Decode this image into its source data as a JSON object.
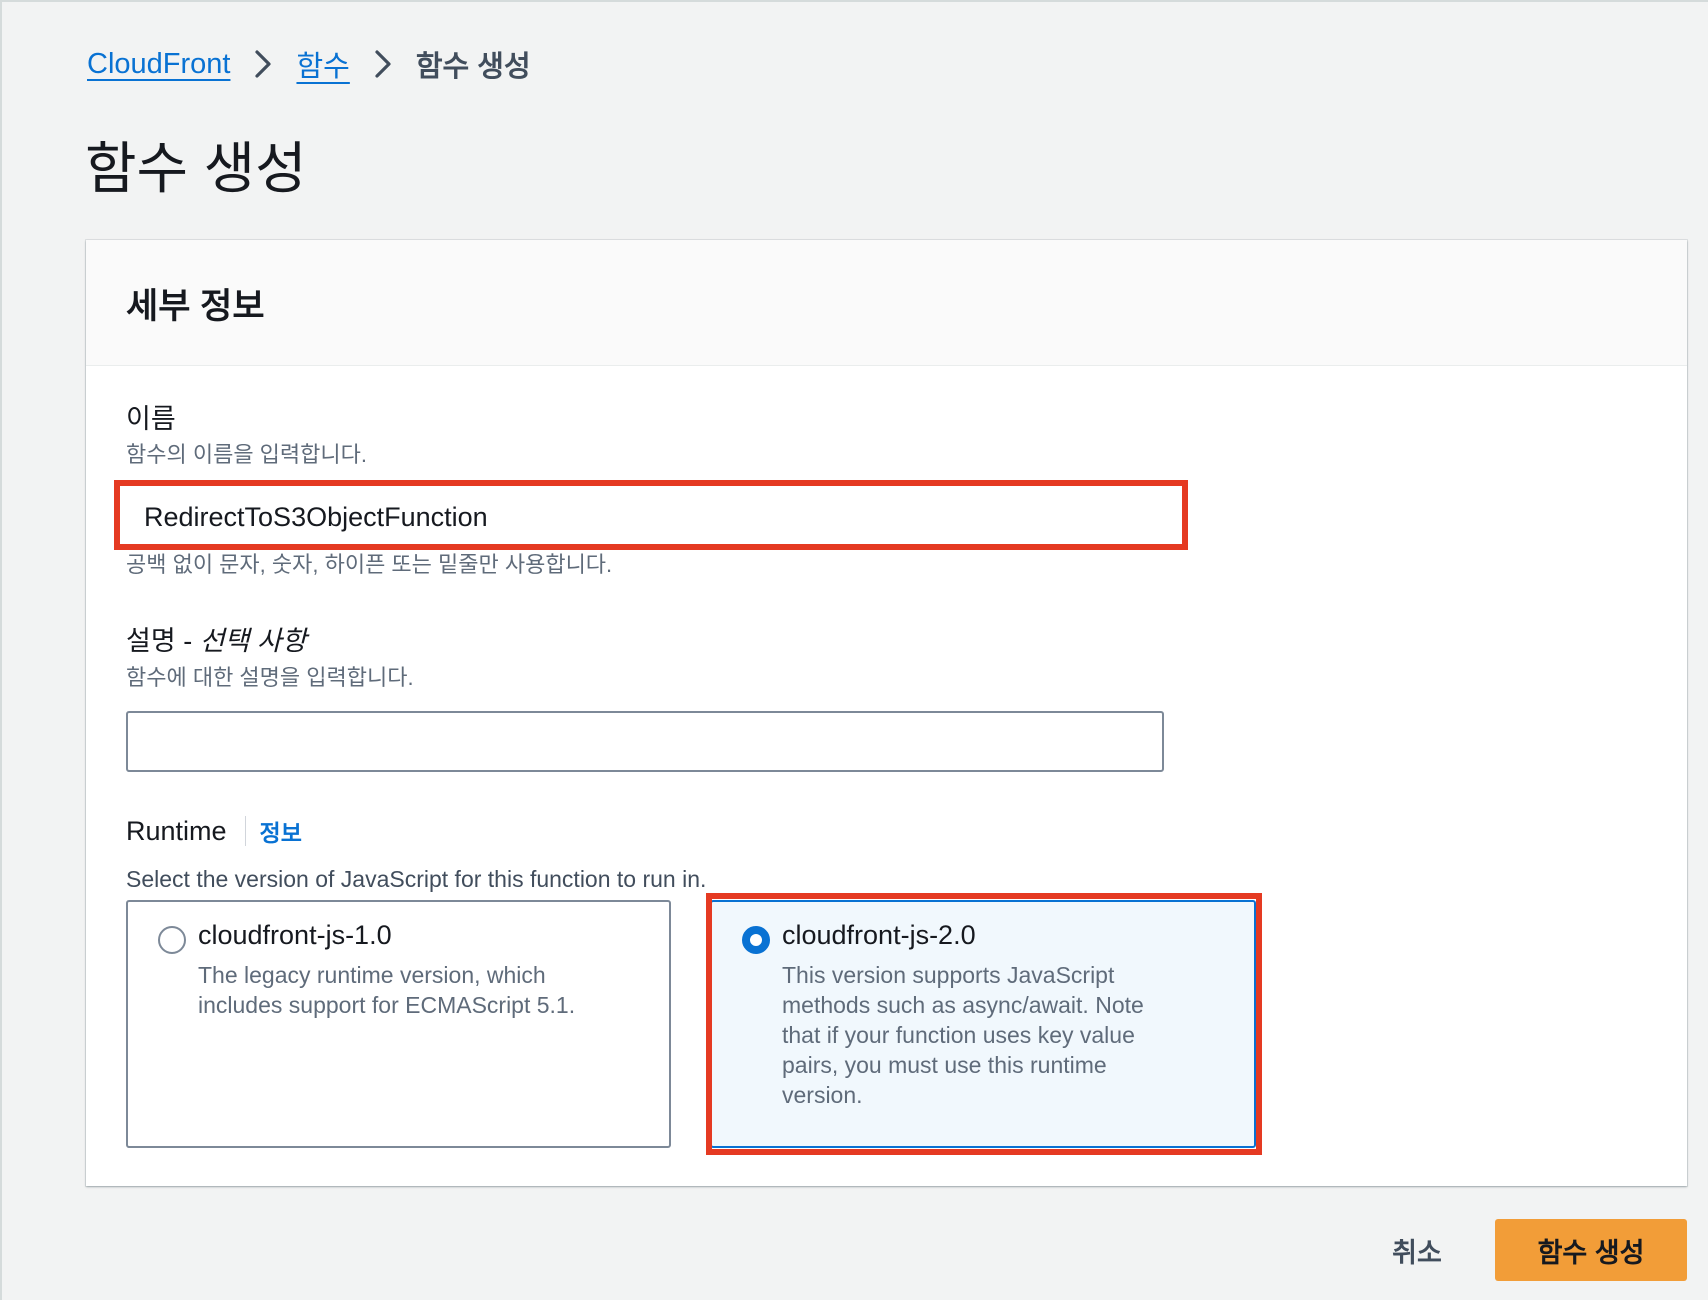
{
  "breadcrumb": {
    "items": [
      {
        "label": "CloudFront"
      },
      {
        "label": "함수"
      },
      {
        "label": "함수 생성"
      }
    ]
  },
  "page": {
    "title": "함수 생성"
  },
  "panel": {
    "title": "세부 정보"
  },
  "name_field": {
    "label": "이름",
    "description": "함수의 이름을 입력합니다.",
    "value": "RedirectToS3ObjectFunction",
    "constraint": "공백 없이 문자, 숫자, 하이픈 또는 밑줄만 사용합니다."
  },
  "description_field": {
    "label": "설명",
    "label_separator": " - ",
    "optional_label": "선택 사항",
    "description": "함수에 대한 설명을 입력합니다.",
    "value": ""
  },
  "runtime": {
    "label": "Runtime",
    "info_link": "정보",
    "description": "Select the version of JavaScript for this function to run in.",
    "options": [
      {
        "title": "cloudfront-js-1.0",
        "description": "The legacy runtime version, which includes support for ECMAScript 5.1.",
        "selected": false
      },
      {
        "title": "cloudfront-js-2.0",
        "description": "This version supports JavaScript methods such as async/await. Note that if your function uses key value pairs, you must use this runtime version.",
        "selected": true
      }
    ]
  },
  "actions": {
    "cancel_label": "취소",
    "submit_label": "함수 생성"
  },
  "colors": {
    "accent": "#0972d3",
    "primary_button": "#f29d38",
    "highlight": "#e53a22",
    "selected_tile_bg": "#f1f8fd"
  },
  "icons": {
    "breadcrumb_separator": "chevron-right-icon"
  }
}
